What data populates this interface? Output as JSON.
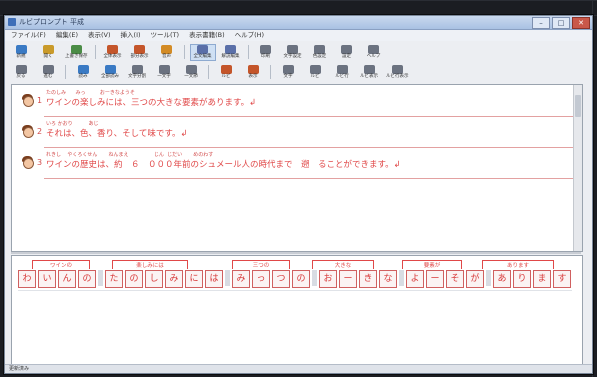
{
  "window": {
    "title": "ルビプロンプト 平成",
    "close_glyph": "✕",
    "min_glyph": "–",
    "max_glyph": "□"
  },
  "menu": [
    "ファイル(F)",
    "編集(E)",
    "表示(V)",
    "挿入(I)",
    "ツール(T)",
    "表示書籍(B)",
    "ヘルプ(H)"
  ],
  "toolbar1": [
    {
      "label": "新規",
      "color": "#3a7ac4"
    },
    {
      "label": "開く",
      "color": "#c99a2a"
    },
    {
      "label": "上書き保存",
      "color": "#4a8c46"
    },
    {
      "label": "全体表示",
      "color": "#c4552a"
    },
    {
      "label": "部分表示",
      "color": "#c4552a"
    },
    {
      "label": "音声",
      "color": "#d38b25"
    },
    {
      "label": "全文編集",
      "color": "#5a6fa8"
    },
    {
      "label": "解説編集",
      "color": "#5a6fa8"
    },
    {
      "label": "印刷",
      "color": "#6b7280"
    },
    {
      "label": "文字設定",
      "color": "#6b7280"
    },
    {
      "label": "色設定",
      "color": "#6b7280"
    },
    {
      "label": "設定",
      "color": "#6b7280"
    },
    {
      "label": "ヘルプ",
      "color": "#6b7280"
    }
  ],
  "toolbar2": [
    {
      "label": "戻る",
      "color": "#6b7280"
    },
    {
      "label": "進む",
      "color": "#6b7280"
    },
    {
      "label": "読み",
      "color": "#3a7ac4"
    },
    {
      "label": "全部読み",
      "color": "#3a7ac4"
    },
    {
      "label": "文字分割",
      "color": "#6b7280"
    },
    {
      "label": "一文字",
      "color": "#6b7280"
    },
    {
      "label": "一文節",
      "color": "#6b7280"
    },
    {
      "label": "ルビ",
      "color": "#c4552a"
    },
    {
      "label": "表示",
      "color": "#c4552a"
    },
    {
      "label": "文字",
      "color": "#6b7280"
    },
    {
      "label": "ルビ",
      "color": "#6b7280"
    },
    {
      "label": "ルビ行",
      "color": "#6b7280"
    },
    {
      "label": "ルビ表示",
      "color": "#6b7280"
    },
    {
      "label": "ルビ行表示",
      "color": "#6b7280"
    }
  ],
  "sentences": [
    {
      "num": "1",
      "ruby": "たのしみ      みっ         おーきなようそ",
      "text": "ワインの楽しみには、三つの大きな要素があります。↲"
    },
    {
      "num": "2",
      "ruby": "いろ かおり          あじ",
      "text": "それは、色、香り、そして味です。↲"
    },
    {
      "num": "3",
      "ruby": "れきし    やくろくせん       ねんまえ                じん  じだい       めのわす",
      "text": "ワインの歴史は、約　６　０００年前のシュメール人の時代まで　遡　ることができます。↲"
    }
  ],
  "word_heads": [
    "ワインの",
    "楽しみには",
    "三つの",
    "大きな",
    "要素が",
    "あります"
  ],
  "kana": [
    "わ",
    "い",
    "ん",
    "の",
    "",
    "た",
    "の",
    "し",
    "み",
    "に",
    "は",
    "",
    "み",
    "っ",
    "つ",
    "の",
    "",
    "お",
    "ー",
    "き",
    "な",
    "",
    "よ",
    "ー",
    "そ",
    "が",
    "",
    "あ",
    "り",
    "ま",
    "す"
  ],
  "status": "更新済み"
}
